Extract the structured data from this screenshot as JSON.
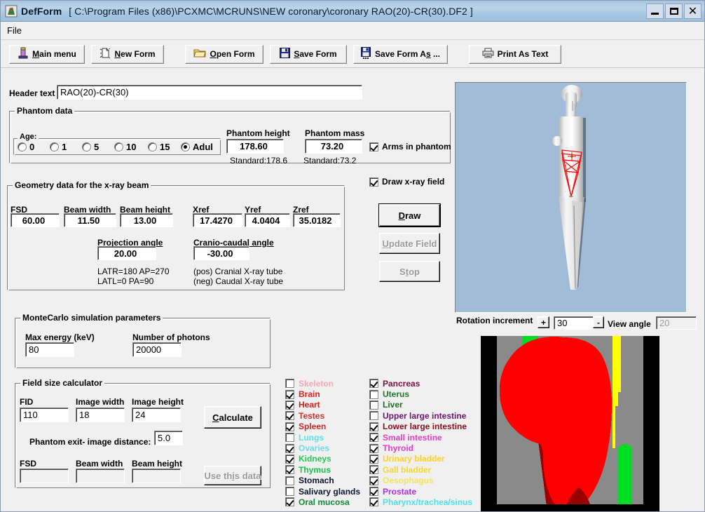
{
  "window": {
    "app_name": "DefForm",
    "file_path": "[ C:\\Program Files (x86)\\PCXMC\\MCRUNS\\NEW coronary\\coronary RAO(20)-CR(30).DF2 ]",
    "minimize": "_",
    "maximize": "□",
    "close": "✕"
  },
  "menu": {
    "file": "File"
  },
  "toolbar": {
    "main_menu": "Main menu",
    "new_form": "New Form",
    "open_form": "Open Form",
    "save_form": "Save Form",
    "save_form_as": "Save Form As ...",
    "print_as_text": "Print As Text"
  },
  "header": {
    "label": "Header text",
    "value": "RAO(20)-CR(30)"
  },
  "phantom_data": {
    "title": "Phantom data",
    "age_label": "Age:",
    "age_options": [
      "0",
      "1",
      "5",
      "10",
      "15",
      "Adul"
    ],
    "age_selected": "Adul",
    "height_label": "Phantom height",
    "height_value": "178.60",
    "height_standard": "Standard:178.6",
    "mass_label": "Phantom mass",
    "mass_value": "73.20",
    "mass_standard": "Standard:73.2",
    "arms_label": "Arms in phantom",
    "arms_checked": true
  },
  "geometry": {
    "title": "Geometry data for the x-ray beam",
    "fields": [
      {
        "label": "FSD",
        "value": "60.00"
      },
      {
        "label": "Beam width",
        "value": "11.50"
      },
      {
        "label": "Beam height",
        "value": "13.00"
      },
      {
        "label": "Xref",
        "value": "17.4270"
      },
      {
        "label": "Yref",
        "value": "4.0404"
      },
      {
        "label": "Zref",
        "value": "35.0182"
      }
    ],
    "projection_label": "Projection angle",
    "projection_value": "20.00",
    "cranio_label": "Cranio-caudal angle",
    "cranio_value": "-30.00",
    "note_latr": "LATR=180  AP=270",
    "note_latl": "LATL=0     PA=90",
    "note_pos": "(pos) Cranial X-ray tube",
    "note_neg": "(neg) Caudal X-ray tube"
  },
  "montecarlo": {
    "title": "MonteCarlo simulation parameters",
    "max_energy_label": "Max energy (keV)",
    "max_energy_value": "80",
    "photons_label": "Number of photons",
    "photons_value": "20000"
  },
  "field_calc": {
    "title": "Field size calculator",
    "fid_label": "FID",
    "fid_value": "110",
    "image_width_label": "Image width",
    "image_width_value": "18",
    "image_height_label": "Image height",
    "image_height_value": "24",
    "exit_distance_label": "Phantom exit- image distance:",
    "exit_distance_value": "5.0",
    "fsd_label": "FSD",
    "fsd_value": "",
    "beam_width_label": "Beam width",
    "beam_width_value": "",
    "beam_height_label": "Beam height",
    "beam_height_value": "",
    "calculate_button": "Calculate",
    "use_this_data_button": "Use this data"
  },
  "draw_panel": {
    "draw_xray_field_label": "Draw x-ray field",
    "draw_xray_field_checked": true,
    "draw_button": "Draw",
    "update_field_button": "Update Field",
    "stop_button": "Stop"
  },
  "rotation": {
    "label": "Rotation increment",
    "plus": "+",
    "minus": "-",
    "increment_value": "30",
    "view_angle_label": "View angle",
    "view_angle_value": "20"
  },
  "organs": {
    "left_column": [
      {
        "name": "Skeleton",
        "checked": false,
        "color": "#f4a9b8"
      },
      {
        "name": "Brain",
        "checked": true,
        "color": "#e02020"
      },
      {
        "name": "Heart",
        "checked": true,
        "color": "#d02020"
      },
      {
        "name": "Testes",
        "checked": true,
        "color": "#d03030"
      },
      {
        "name": "Spleen",
        "checked": true,
        "color": "#d02828"
      },
      {
        "name": "Lungs",
        "checked": false,
        "color": "#59e5e5"
      },
      {
        "name": "Ovaries",
        "checked": true,
        "color": "#6fd8e8"
      },
      {
        "name": "Kidneys",
        "checked": true,
        "color": "#22cc55"
      },
      {
        "name": "Thymus",
        "checked": true,
        "color": "#18c050"
      },
      {
        "name": "Stomach",
        "checked": false,
        "color": "#101030"
      },
      {
        "name": "Salivary glands",
        "checked": false,
        "color": "#101030"
      },
      {
        "name": "Oral mucosa",
        "checked": true,
        "color": "#138a3a"
      }
    ],
    "right_column": [
      {
        "name": "Pancreas",
        "checked": true,
        "color": "#7d1040"
      },
      {
        "name": "Uterus",
        "checked": false,
        "color": "#1d7a2a"
      },
      {
        "name": "Liver",
        "checked": false,
        "color": "#1d6b20"
      },
      {
        "name": "Upper large intestine",
        "checked": false,
        "color": "#6b1670"
      },
      {
        "name": "Lower large intestine",
        "checked": true,
        "color": "#8a1020"
      },
      {
        "name": "Small intestine",
        "checked": true,
        "color": "#e040c8"
      },
      {
        "name": "Thyroid",
        "checked": true,
        "color": "#e83ad0"
      },
      {
        "name": "Urinary bladder",
        "checked": true,
        "color": "#ffd020"
      },
      {
        "name": "Gall bladder",
        "checked": true,
        "color": "#f5d82a"
      },
      {
        "name": "Oesophagus",
        "checked": true,
        "color": "#f2e45a"
      },
      {
        "name": "Prostate",
        "checked": true,
        "color": "#b030e8"
      },
      {
        "name": "Pharynx/trachea/sinus",
        "checked": true,
        "color": "#4fe0e8"
      }
    ]
  },
  "colors": {
    "title_gradient_start": "#a8c4e0",
    "title_gradient_end": "#9dc0dc",
    "face": "#f0f0f0",
    "phantom_bg": "#a2bcd8",
    "beam_red": "#ee1111",
    "organ_red": "#ff0000",
    "organ_dark_red": "#990000",
    "organ_green": "#00dd22",
    "organ_yellow": "#ffff00",
    "organ_gray": "#8a8a8a"
  }
}
